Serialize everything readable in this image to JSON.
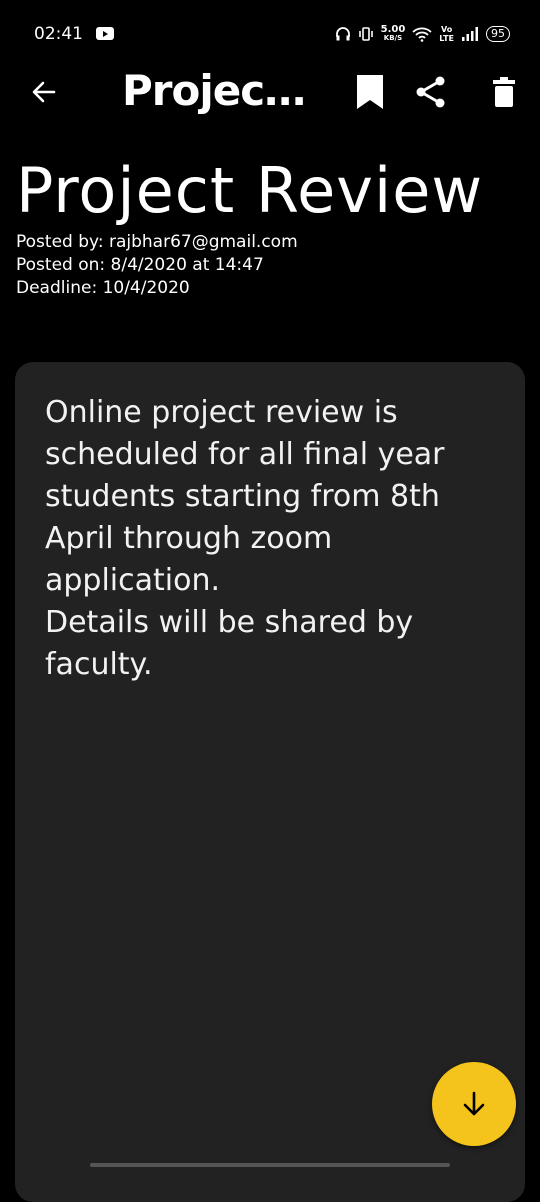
{
  "status_bar": {
    "time": "02:41",
    "speed_value": "5.00",
    "speed_unit": "KB/S",
    "volte_top": "Vo",
    "volte_bottom": "LTE",
    "battery": "95"
  },
  "app_bar": {
    "title": "Project Review",
    "icons": [
      "back-arrow-icon",
      "bookmark-icon",
      "share-icon",
      "delete-icon"
    ]
  },
  "post": {
    "title": "Project Review",
    "posted_by": "Posted by: rajbhar67@gmail.com",
    "posted_on": "Posted on: 8/4/2020 at 14:47",
    "deadline": "Deadline: 10/4/2020",
    "body": "Online project review is scheduled for all final year students starting from 8th April through zoom application.\nDetails will be shared by faculty."
  },
  "fab": {
    "icon": "arrow-down-icon"
  },
  "colors": {
    "background": "#000000",
    "card": "#222223",
    "accent": "#f4c31c"
  }
}
